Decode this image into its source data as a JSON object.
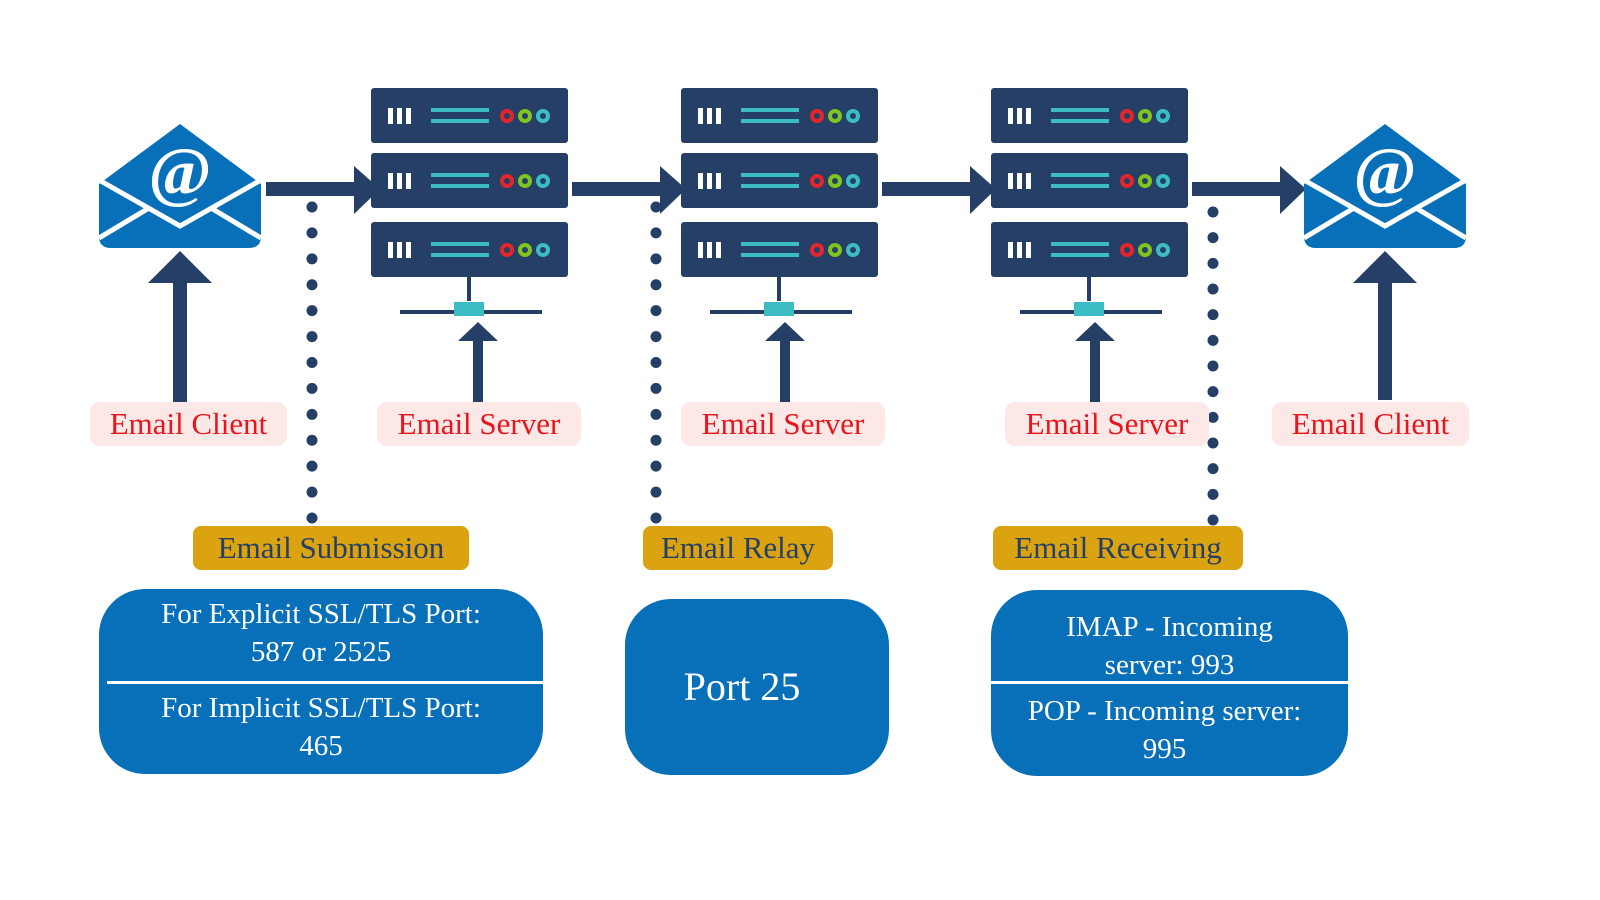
{
  "colors": {
    "navy": "#253f66",
    "envelope_blue": "#0770b9",
    "teal": "#3cbdc4",
    "led_red": "#e2262c",
    "led_green": "#7fc41f",
    "led_teal": "#3cbdc4",
    "role_label_bg": "#fde8e8",
    "role_label_text": "#e8151b",
    "stage_label_bg": "#dca311",
    "port_box_bg": "#0770b9"
  },
  "nodes": [
    {
      "id": "sender-client",
      "type": "envelope",
      "icon": "envelope-at-icon",
      "label": "Email Client"
    },
    {
      "id": "submission-server",
      "type": "server-rack",
      "icon": "server-stack-icon",
      "label": "Email Server"
    },
    {
      "id": "relay-server",
      "type": "server-rack",
      "icon": "server-stack-icon",
      "label": "Email Server"
    },
    {
      "id": "receiving-server",
      "type": "server-rack",
      "icon": "server-stack-icon",
      "label": "Email Server"
    },
    {
      "id": "recipient-client",
      "type": "envelope",
      "icon": "envelope-at-icon",
      "label": "Email Client"
    }
  ],
  "stages": [
    {
      "label": "Email Submission",
      "ports": [
        "For Explicit SSL/TLS Port: 587 or 2525",
        "For Implicit SSL/TLS Port: 465"
      ],
      "port_lines": [
        [
          "For Explicit SSL/TLS Port:",
          "587 or 2525"
        ],
        [
          "For Implicit SSL/TLS Port:",
          "465"
        ]
      ]
    },
    {
      "label": "Email Relay",
      "ports": [
        "Port 25"
      ],
      "port_lines": [
        [
          "Port 25"
        ]
      ]
    },
    {
      "label": "Email Receiving",
      "ports": [
        "IMAP - Incoming server: 993",
        "POP -  Incoming server: 995"
      ],
      "port_lines": [
        [
          "IMAP - Incoming",
          "server: 993"
        ],
        [
          "POP -  Incoming server:",
          "995"
        ]
      ]
    }
  ],
  "edges": [
    {
      "from": "sender-client",
      "to": "submission-server"
    },
    {
      "from": "submission-server",
      "to": "relay-server"
    },
    {
      "from": "relay-server",
      "to": "receiving-server"
    },
    {
      "from": "receiving-server",
      "to": "recipient-client"
    }
  ]
}
